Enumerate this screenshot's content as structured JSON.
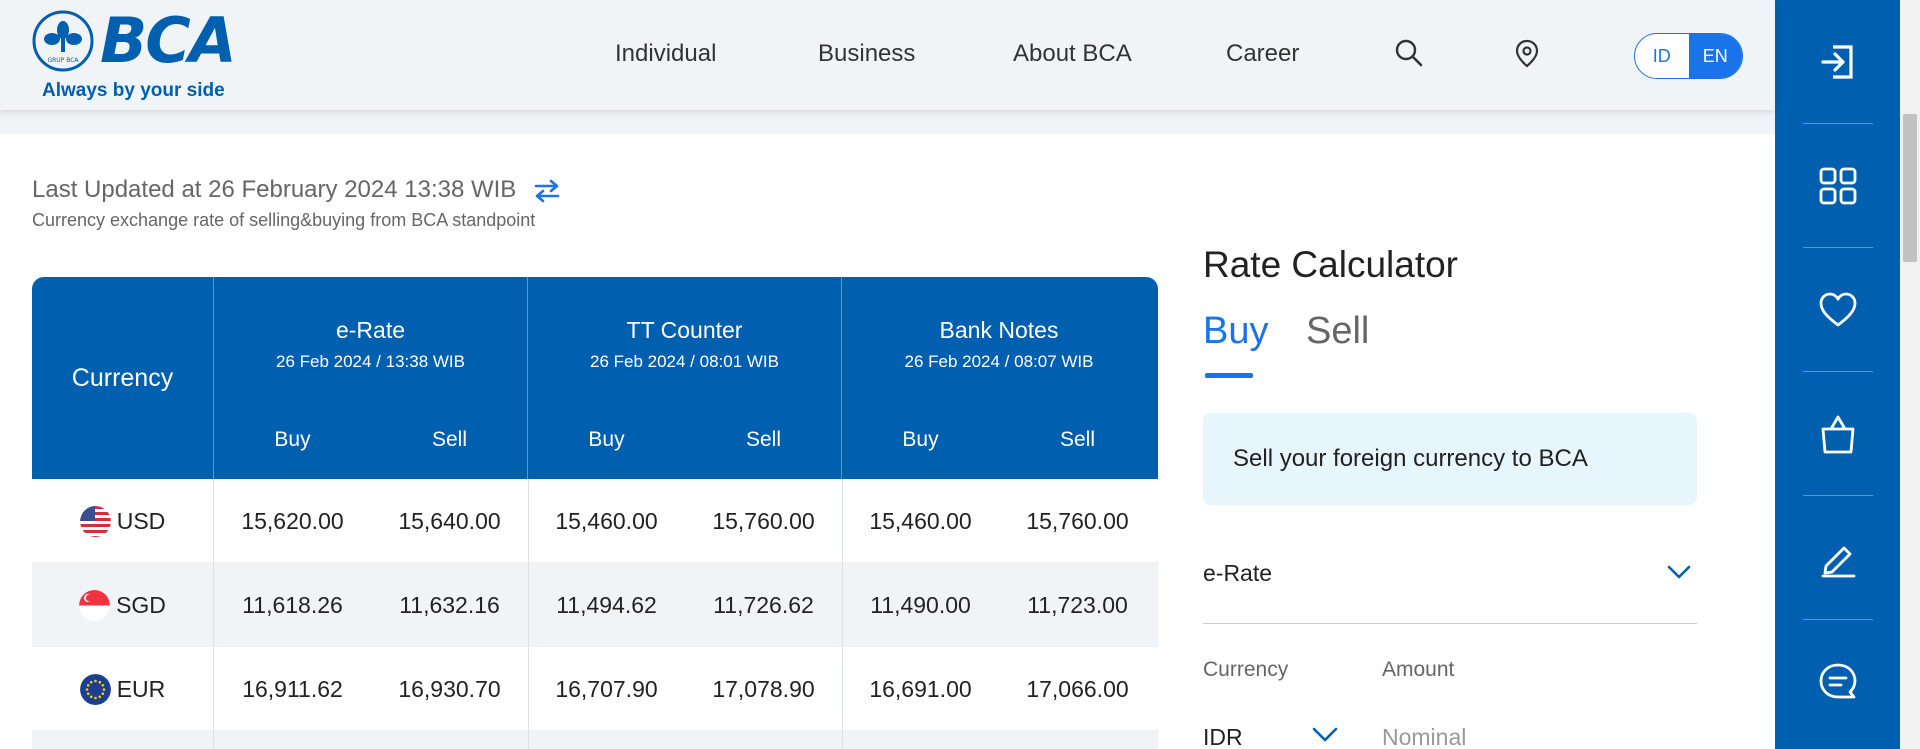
{
  "brand": {
    "name": "BCA",
    "emblem_text": "GRUP BCA",
    "tagline": "Always by your side",
    "color": "#0060af"
  },
  "nav": {
    "items": [
      "Individual",
      "Business",
      "About BCA",
      "Career"
    ],
    "icons": [
      "search-icon",
      "location-pin-icon"
    ],
    "lang": {
      "id": "ID",
      "en": "EN",
      "active": "EN"
    }
  },
  "sidebar": {
    "icons": [
      "login-icon",
      "grid-icon",
      "heart-icon",
      "shopping-bag-icon",
      "pen-icon",
      "chat-icon"
    ]
  },
  "updated": {
    "label": "Last Updated at",
    "date": "26 February 2024 13:38",
    "tz": "WIB",
    "subtitle": "Currency exchange rate of selling&buying from BCA standpoint"
  },
  "table": {
    "currency_header": "Currency",
    "groups": [
      {
        "title": "e-Rate",
        "date": "26 Feb 2024 / 13:38 WIB"
      },
      {
        "title": "TT Counter",
        "date": "26 Feb 2024 / 08:01 WIB"
      },
      {
        "title": "Bank Notes",
        "date": "26 Feb 2024 / 08:07 WIB"
      }
    ],
    "buy_label": "Buy",
    "sell_label": "Sell",
    "rows": [
      {
        "code": "USD",
        "values": [
          "15,620.00",
          "15,640.00",
          "15,460.00",
          "15,760.00",
          "15,460.00",
          "15,760.00"
        ]
      },
      {
        "code": "SGD",
        "values": [
          "11,618.26",
          "11,632.16",
          "11,494.62",
          "11,726.62",
          "11,490.00",
          "11,723.00"
        ]
      },
      {
        "code": "EUR",
        "values": [
          "16,911.62",
          "16,930.70",
          "16,707.90",
          "17,078.90",
          "16,691.00",
          "17,066.00"
        ]
      }
    ]
  },
  "calculator": {
    "title": "Rate Calculator",
    "tabs": [
      "Buy",
      "Sell"
    ],
    "active_tab": "Buy",
    "info": "Sell your foreign currency to BCA",
    "rate_type": "e-Rate",
    "currency_label": "Currency",
    "amount_label": "Amount",
    "currency_value": "IDR",
    "amount_placeholder": "Nominal"
  }
}
